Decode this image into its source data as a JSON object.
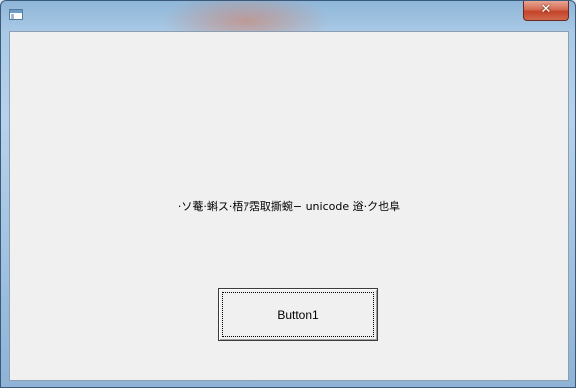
{
  "window": {
    "title": "",
    "close_glyph": "✕",
    "icon": "application-window-icon"
  },
  "main": {
    "label_text": "·ソ菴·蝌ス·梧ｱ霑取撕蜿− unicode 逧·ク也阜",
    "button1_label": "Button1"
  },
  "colors": {
    "client_background": "#f0f0f0",
    "close_button": "#c44329",
    "frame": "#a9c9e6"
  }
}
